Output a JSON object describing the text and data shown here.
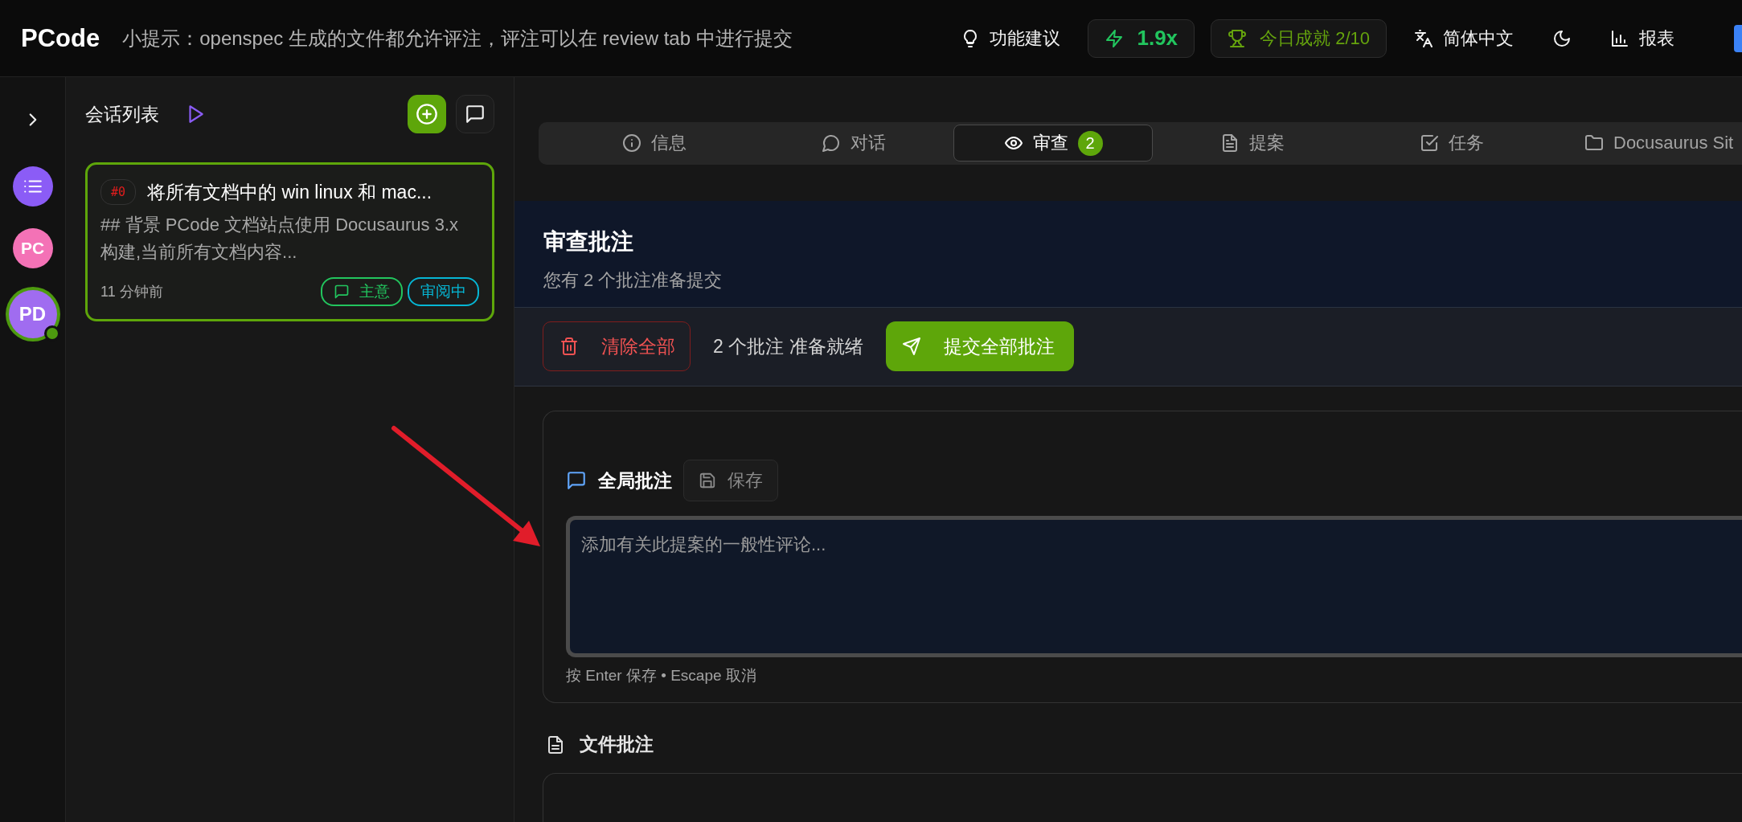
{
  "topbar": {
    "logo": "PCode",
    "tip": "小提示：openspec 生成的文件都允许评注，评注可以在 review tab 中进行提交",
    "feature_suggest": "功能建议",
    "speed": "1.9x",
    "achievement": "今日成就 2/10",
    "language": "简体中文",
    "report": "报表"
  },
  "rail": {
    "avatars": [
      {
        "kind": "list",
        "color": "#8b5cf6",
        "selected": false
      },
      {
        "kind": "initials",
        "label": "PC",
        "color": "#f472b6",
        "selected": false
      },
      {
        "kind": "initials",
        "label": "PD",
        "color": "#a06cf0",
        "selected": true
      }
    ]
  },
  "sessions": {
    "title": "会话列表",
    "items": [
      {
        "number": "#0",
        "title": "将所有文档中的 win linux 和 mac...",
        "preview": "## 背景 PCode 文档站点使用 Docusaurus 3.x 构建,当前所有文档内容...",
        "time": "11 分钟前",
        "selected": true,
        "tags": [
          {
            "label": "主意",
            "color": "#22c55e",
            "kind": "icon"
          },
          {
            "label": "审阅中",
            "color": "#06b6d4",
            "kind": "plain"
          }
        ]
      }
    ]
  },
  "tabs": [
    {
      "label": "信息",
      "kind": "info",
      "selected": false
    },
    {
      "label": "对话",
      "kind": "chat",
      "selected": false
    },
    {
      "label": "审查",
      "kind": "eye",
      "badge": "2",
      "selected": true
    },
    {
      "label": "提案",
      "kind": "doc",
      "selected": false
    },
    {
      "label": "任务",
      "kind": "check",
      "selected": false
    },
    {
      "label": "Docusaurus Sit",
      "kind": "folder",
      "selected": false
    }
  ],
  "review": {
    "title": "审查批注",
    "subtitle": "您有 2 个批注准备提交",
    "clear_button": "清除全部",
    "status": "2 个批注 准备就绪",
    "submit_button": "提交全部批注",
    "global_comment": {
      "title": "全局批注",
      "save_button": "保存",
      "placeholder": "添加有关此提案的一般性评论...",
      "hint": "按 Enter 保存 • Escape 取消"
    },
    "file_comments": {
      "title": "文件批注"
    }
  }
}
